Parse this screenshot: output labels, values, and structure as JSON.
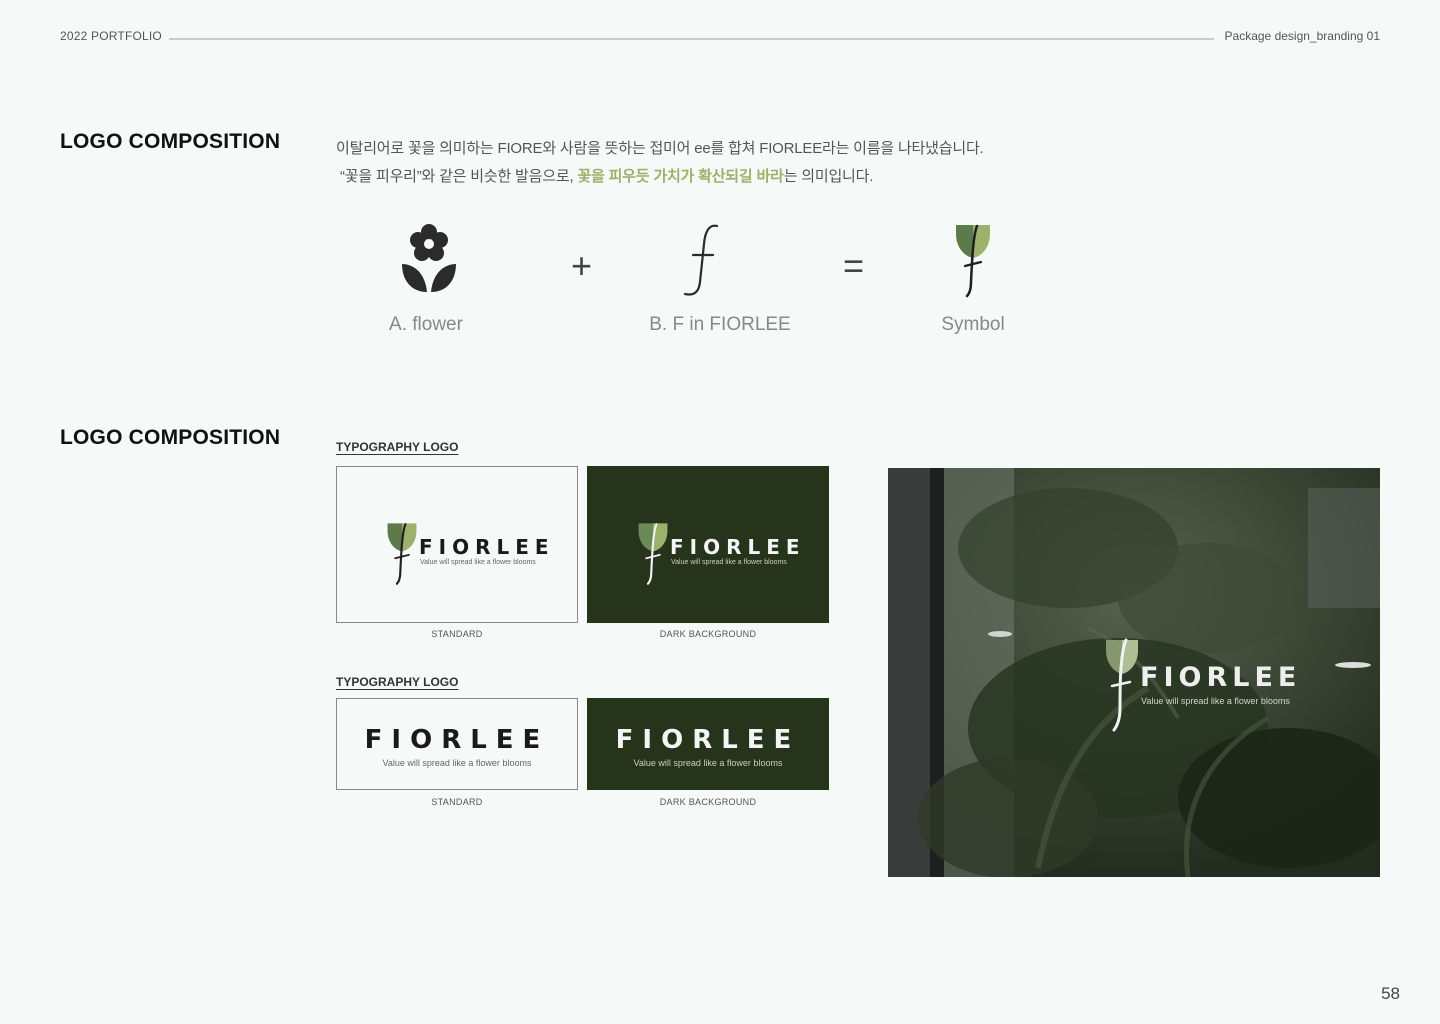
{
  "header": {
    "left": "2022 PORTFOLIO",
    "right": "Package design_branding 01"
  },
  "section1": {
    "title": "LOGO COMPOSITION",
    "desc_line1": "이탈리어로 꽃을 의미하는 FIORE와 사람을 뜻하는 접미어 ee를 합쳐 FIORLEE라는 이름을 나타냈습니다.",
    "desc_line2_pre": "“꽃을 피우리”와 같은 비슷한 발음으로, ",
    "desc_line2_hl": "꽃을 피우듯 가치가 확산되길 바라",
    "desc_line2_post": "는 의미입니다.",
    "items": [
      {
        "label": "A. flower",
        "icon": "flower-icon"
      },
      {
        "label": "B. F in FIORLEE",
        "icon": "letter-f-icon"
      },
      {
        "label": "Symbol",
        "icon": "symbol-icon"
      }
    ],
    "plus": "+",
    "equals": "="
  },
  "section2": {
    "title": "LOGO COMPOSITION",
    "group1_title": "TYPOGRAPHY LOGO",
    "group2_title": "TYPOGRAPHY LOGO",
    "brand": "FIORLEE",
    "tagline": "Value will spread like a flower blooms",
    "cap_standard": "STANDARD",
    "cap_dark": "DARK BACKGROUND"
  },
  "page_number": "58",
  "colors": {
    "accent_green": "#9cb26a",
    "dark_green": "#25341b",
    "leaf_dark": "#5c7a4a",
    "leaf_light": "#9cb26a",
    "background": "#f5f9f7"
  }
}
